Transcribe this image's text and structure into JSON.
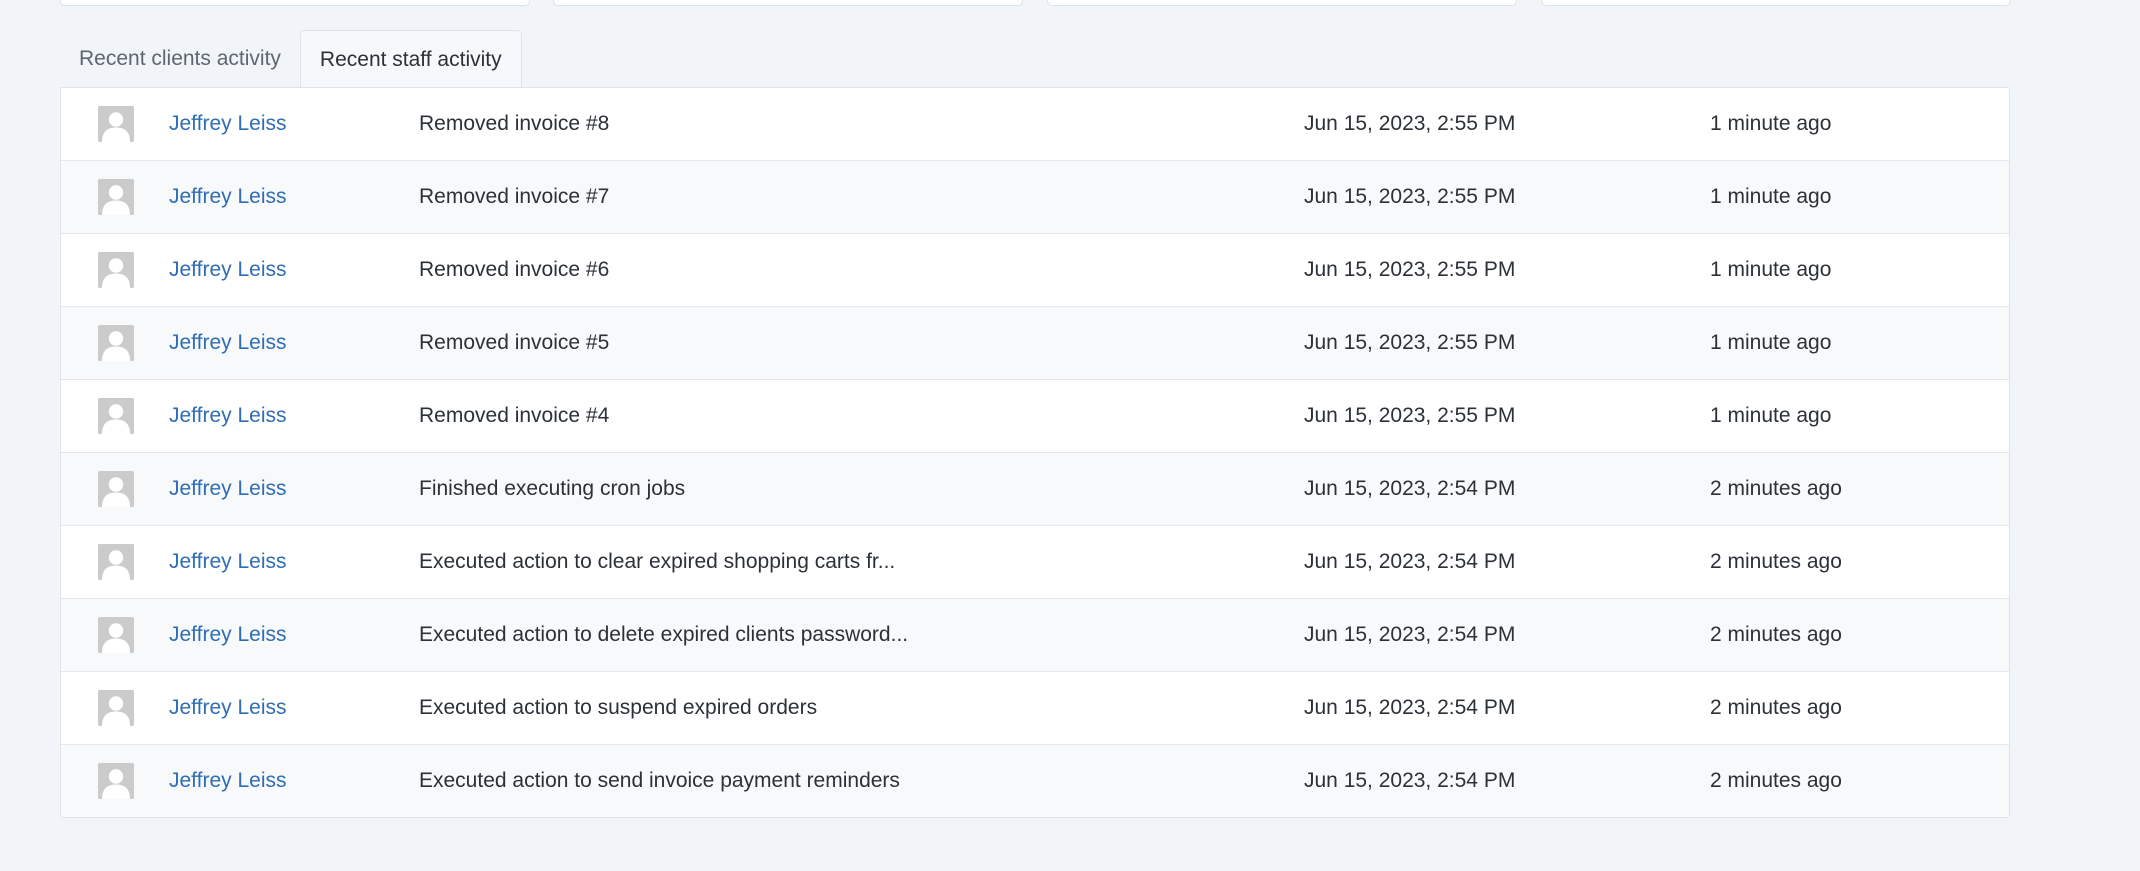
{
  "tabs": [
    {
      "label": "Recent clients activity",
      "active": false
    },
    {
      "label": "Recent staff activity",
      "active": true
    }
  ],
  "activity": [
    {
      "name": "Jeffrey Leiss",
      "action": "Removed invoice #8",
      "date": "Jun 15, 2023, 2:55 PM",
      "ago": "1 minute ago"
    },
    {
      "name": "Jeffrey Leiss",
      "action": "Removed invoice #7",
      "date": "Jun 15, 2023, 2:55 PM",
      "ago": "1 minute ago"
    },
    {
      "name": "Jeffrey Leiss",
      "action": "Removed invoice #6",
      "date": "Jun 15, 2023, 2:55 PM",
      "ago": "1 minute ago"
    },
    {
      "name": "Jeffrey Leiss",
      "action": "Removed invoice #5",
      "date": "Jun 15, 2023, 2:55 PM",
      "ago": "1 minute ago"
    },
    {
      "name": "Jeffrey Leiss",
      "action": "Removed invoice #4",
      "date": "Jun 15, 2023, 2:55 PM",
      "ago": "1 minute ago"
    },
    {
      "name": "Jeffrey Leiss",
      "action": "Finished executing cron jobs",
      "date": "Jun 15, 2023, 2:54 PM",
      "ago": "2 minutes ago"
    },
    {
      "name": "Jeffrey Leiss",
      "action": "Executed action to clear expired shopping carts fr...",
      "date": "Jun 15, 2023, 2:54 PM",
      "ago": "2 minutes ago"
    },
    {
      "name": "Jeffrey Leiss",
      "action": "Executed action to delete expired clients password...",
      "date": "Jun 15, 2023, 2:54 PM",
      "ago": "2 minutes ago"
    },
    {
      "name": "Jeffrey Leiss",
      "action": "Executed action to suspend expired orders",
      "date": "Jun 15, 2023, 2:54 PM",
      "ago": "2 minutes ago"
    },
    {
      "name": "Jeffrey Leiss",
      "action": "Executed action to send invoice payment reminders",
      "date": "Jun 15, 2023, 2:54 PM",
      "ago": "2 minutes ago"
    }
  ]
}
